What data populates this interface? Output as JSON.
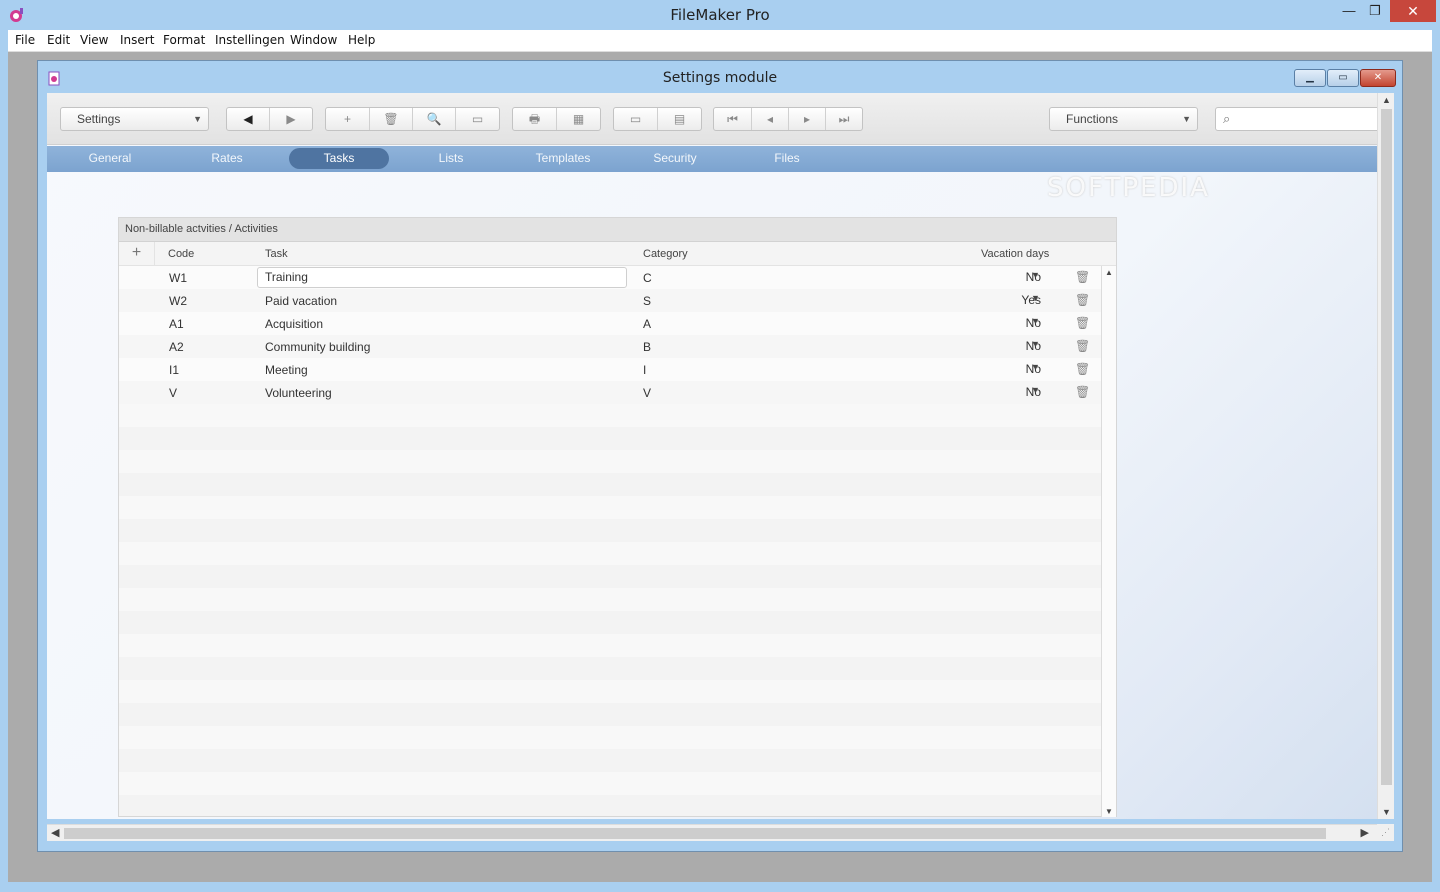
{
  "app": {
    "title": "FileMaker Pro",
    "window_controls": {
      "minimize": "—",
      "maximize": "❐",
      "close": "✕"
    }
  },
  "menubar": {
    "items": [
      "File",
      "Edit",
      "View",
      "Insert",
      "Format",
      "Instellingen",
      "Window",
      "Help"
    ]
  },
  "document": {
    "title": "Settings module",
    "window_controls": {
      "minimize": "▁",
      "maximize": "▭",
      "close": "✕"
    }
  },
  "toolbar": {
    "layout_select": "Settings",
    "functions_select": "Functions",
    "search_placeholder": "",
    "icons": {
      "nav": [
        "◀",
        "▶"
      ],
      "record": [
        "+",
        "🗑",
        "🔍",
        "▭"
      ],
      "output": [
        "🖶",
        "▦"
      ],
      "view": [
        "▭",
        "▤"
      ],
      "paging": [
        "⏮",
        "◂",
        "▸",
        "⏭"
      ]
    }
  },
  "tabs": [
    {
      "label": "General",
      "active": false
    },
    {
      "label": "Rates",
      "active": false
    },
    {
      "label": "Tasks",
      "active": true
    },
    {
      "label": "Lists",
      "active": false
    },
    {
      "label": "Templates",
      "active": false
    },
    {
      "label": "Security",
      "active": false
    },
    {
      "label": "Files",
      "active": false
    }
  ],
  "portal": {
    "title": "Non-billable actvities / Activities",
    "add_label": "+",
    "columns": {
      "code": "Code",
      "task": "Task",
      "category": "Category",
      "vacation": "Vacation days"
    },
    "rows": [
      {
        "code": "W1",
        "task": "Training",
        "category": "C",
        "vacation": "No"
      },
      {
        "code": "W2",
        "task": "Paid vacation",
        "category": "S",
        "vacation": "Yes"
      },
      {
        "code": "A1",
        "task": "Acquisition",
        "category": "A",
        "vacation": "No"
      },
      {
        "code": "A2",
        "task": "Community building",
        "category": "B",
        "vacation": "No"
      },
      {
        "code": "I1",
        "task": "Meeting",
        "category": "I",
        "vacation": "No"
      },
      {
        "code": "V",
        "task": "Volunteering",
        "category": "V",
        "vacation": "No"
      }
    ]
  },
  "watermark": "SOFTPEDIA",
  "colors": {
    "tab_active": "#4f74a1",
    "tab_bar": "#8fb3da",
    "window_frame": "#a9cff0",
    "close_red": "#c7473c"
  }
}
